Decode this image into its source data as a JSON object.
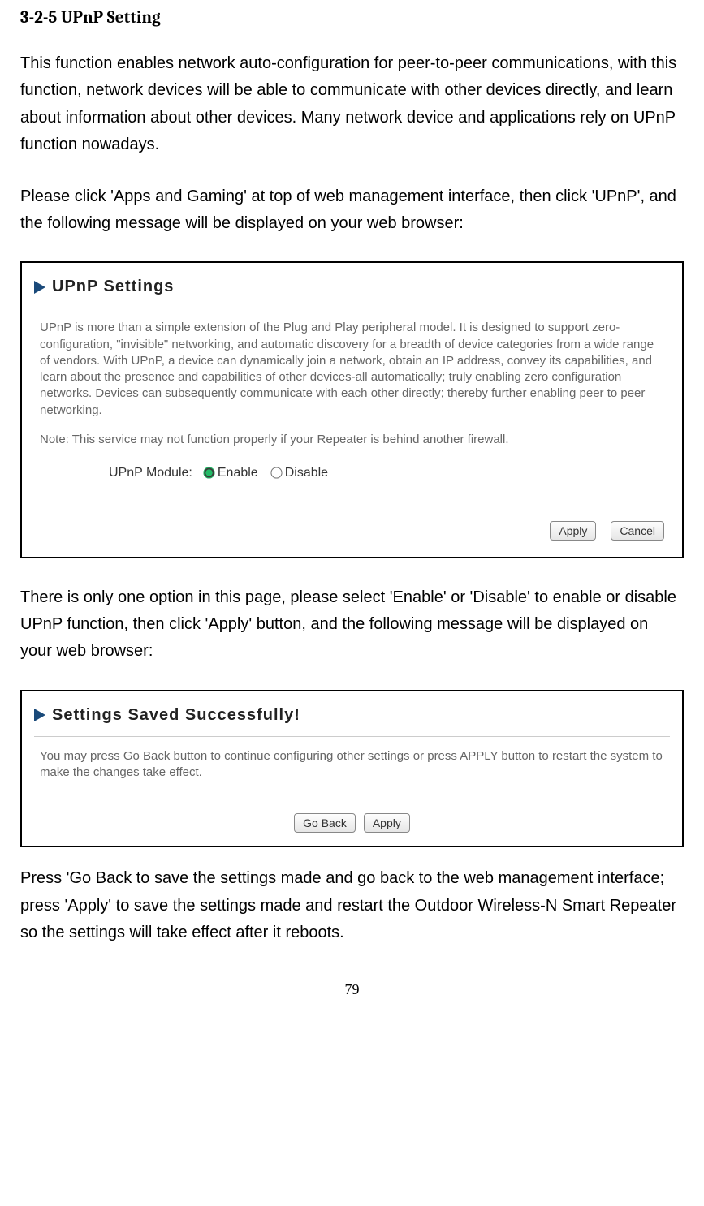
{
  "heading": "3-2-5 UPnP Setting",
  "para1": "This function enables network auto-configuration for peer-to-peer communications, with this function, network devices will be able to communicate with other devices directly, and learn about information about other devices. Many network device and applications rely on UPnP function nowadays.",
  "para2": "Please click 'Apps and Gaming' at top of web management interface, then click 'UPnP', and the following message will be displayed on your web browser:",
  "upnp_panel": {
    "title": "UPnP Settings",
    "description": "UPnP is more than a simple extension of the Plug and Play peripheral model. It is designed to support zero-configuration, \"invisible\" networking, and automatic discovery for a breadth of device categories from a wide range of vendors. With UPnP, a device can dynamically join a network, obtain an IP address, convey its capabilities, and learn about the presence and capabilities of other devices-all automatically; truly enabling zero configuration networks. Devices can subsequently communicate with each other directly; thereby further enabling peer to peer networking.",
    "note": "Note: This service may not function properly if your Repeater is behind another firewall.",
    "module_label": "UPnP Module:",
    "enable_label": "Enable",
    "disable_label": "Disable",
    "apply_label": "Apply",
    "cancel_label": "Cancel"
  },
  "para3": "There is only one option in this page, please select 'Enable' or 'Disable' to enable or disable UPnP function, then click 'Apply' button, and the following message will be displayed on your web browser:",
  "saved_panel": {
    "title": "Settings Saved Successfully!",
    "description": "You may press Go Back button to continue configuring other settings or press APPLY button to restart the system to make the changes take effect.",
    "goback_label": "Go Back",
    "apply_label": "Apply"
  },
  "para4": "Press 'Go Back to save the settings made and go back to the web management interface; press 'Apply' to save the settings made and restart the Outdoor Wireless-N Smart Repeater so the settings will take effect after it reboots.",
  "page_number": "79"
}
